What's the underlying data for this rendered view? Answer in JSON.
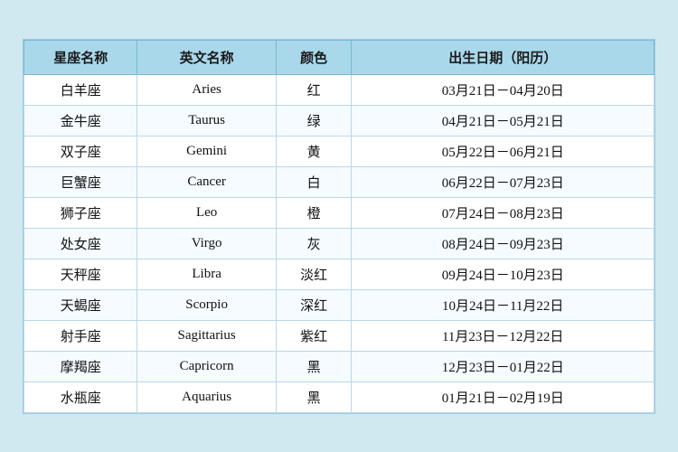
{
  "table": {
    "headers": [
      "星座名称",
      "英文名称",
      "颜色",
      "出生日期（阳历）"
    ],
    "rows": [
      {
        "zh": "白羊座",
        "en": "Aries",
        "color": "红",
        "date": "03月21日－04月20日"
      },
      {
        "zh": "金牛座",
        "en": "Taurus",
        "color": "绿",
        "date": "04月21日－05月21日"
      },
      {
        "zh": "双子座",
        "en": "Gemini",
        "color": "黄",
        "date": "05月22日－06月21日"
      },
      {
        "zh": "巨蟹座",
        "en": "Cancer",
        "color": "白",
        "date": "06月22日－07月23日"
      },
      {
        "zh": "狮子座",
        "en": "Leo",
        "color": "橙",
        "date": "07月24日－08月23日"
      },
      {
        "zh": "处女座",
        "en": "Virgo",
        "color": "灰",
        "date": "08月24日－09月23日"
      },
      {
        "zh": "天秤座",
        "en": "Libra",
        "color": "淡红",
        "date": "09月24日－10月23日"
      },
      {
        "zh": "天蝎座",
        "en": "Scorpio",
        "color": "深红",
        "date": "10月24日－11月22日"
      },
      {
        "zh": "射手座",
        "en": "Sagittarius",
        "color": "紫红",
        "date": "11月23日－12月22日"
      },
      {
        "zh": "摩羯座",
        "en": "Capricorn",
        "color": "黑",
        "date": "12月23日－01月22日"
      },
      {
        "zh": "水瓶座",
        "en": "Aquarius",
        "color": "黑",
        "date": "01月21日－02月19日"
      }
    ]
  }
}
